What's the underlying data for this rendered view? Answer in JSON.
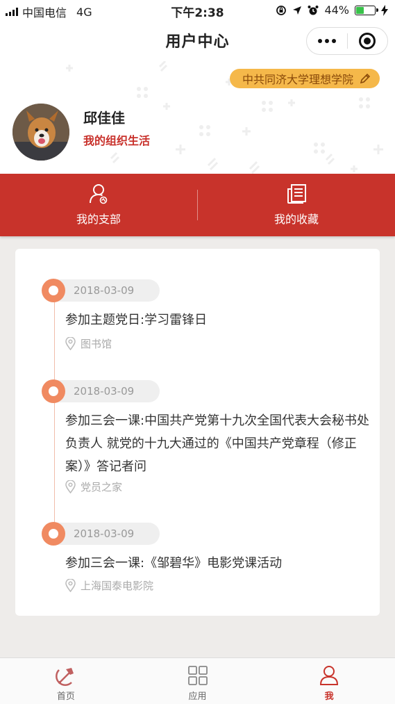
{
  "status_bar": {
    "carrier": "中国电信",
    "network": "4G",
    "time": "下午2:38",
    "battery_text": "44%",
    "battery_level": 0.44
  },
  "navbar": {
    "title": "用户中心",
    "more_icon": "more-dots-icon",
    "close_icon": "target-circle-icon"
  },
  "profile": {
    "org_tag": "中共同济大学理想学院",
    "name": "邱佳佳",
    "subtitle": "我的组织生活"
  },
  "actions": [
    {
      "label": "我的支部",
      "icon": "user-party-icon"
    },
    {
      "label": "我的收藏",
      "icon": "document-icon"
    }
  ],
  "timeline": [
    {
      "date": "2018-03-09",
      "title": "参加主题党日:学习雷锋日",
      "location": "图书馆"
    },
    {
      "date": "2018-03-09",
      "title": "参加三会一课:中国共产党第十九次全国代表大会秘书处负责人 就党的十九大通过的《中国共产党章程（修正案）》答记者问",
      "location": "党员之家"
    },
    {
      "date": "2018-03-09",
      "title": "参加三会一课:《邹碧华》电影党课活动",
      "location": "上海国泰电影院"
    }
  ],
  "tabbar": [
    {
      "label": "首页",
      "icon": "party-emblem-icon",
      "active": false
    },
    {
      "label": "应用",
      "icon": "grid-icon",
      "active": false
    },
    {
      "label": "我",
      "icon": "person-icon",
      "active": true
    }
  ],
  "colors": {
    "primary_red": "#c8332b",
    "timeline_orange": "#f08a61",
    "tag_yellow": "#f5b84a",
    "battery_green": "#38c24a"
  }
}
